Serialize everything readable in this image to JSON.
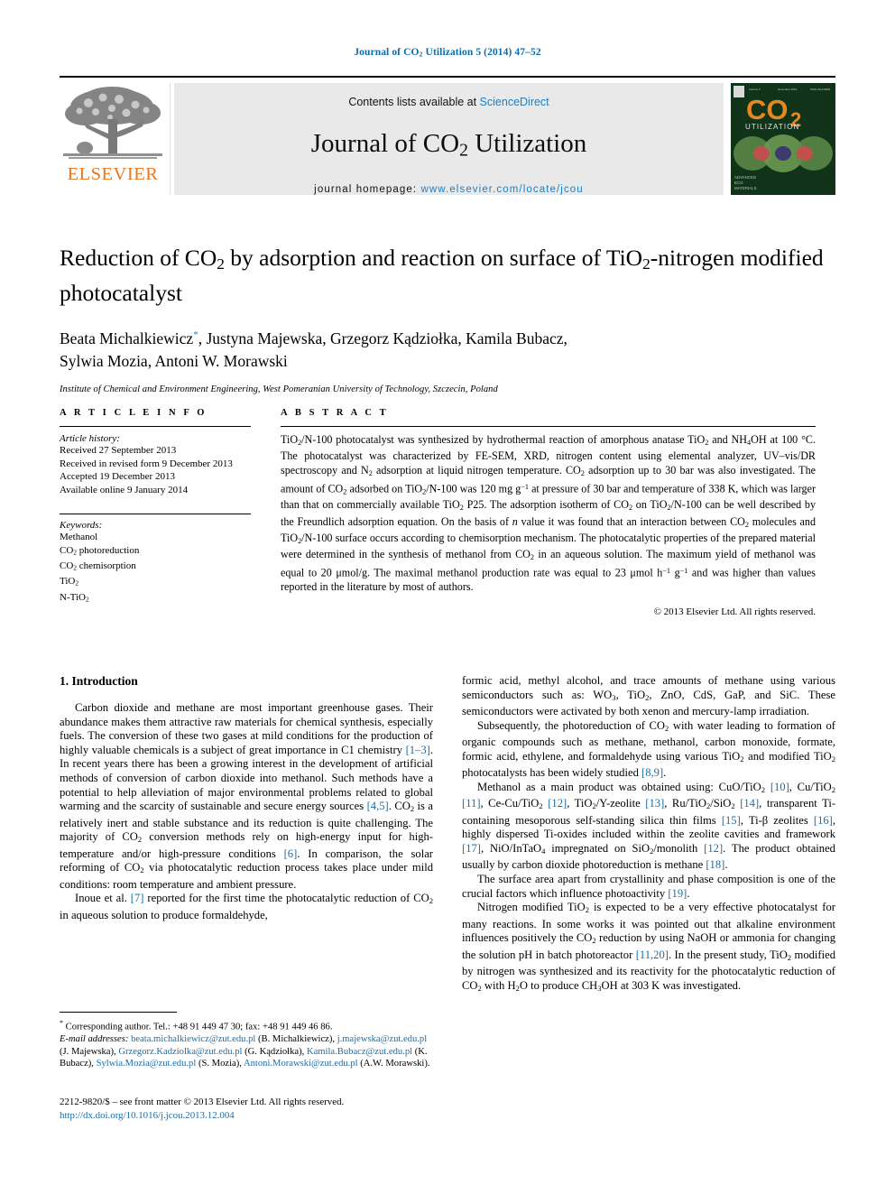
{
  "running_head": "Journal of CO2 Utilization 5 (2014) 47–52",
  "masthead": {
    "contents_prefix": "Contents lists available at ",
    "sciencedirect": "ScienceDirect",
    "journal_title": "Journal of CO2 Utilization",
    "homepage_label": "journal homepage: ",
    "homepage_url": "www.elsevier.com/locate/jcou",
    "publisher": "ELSEVIER",
    "cover": {
      "title": "CO",
      "subscript": "2",
      "subtitle": "UTILIZATION",
      "top_bar": "Volume 5    December 2014    ISSN 2212-9820",
      "footer": "ADVANCED\nECO\nMATERIALS"
    },
    "accent_link_color": "#1b7fc4",
    "elsevier_orange": "#E87722",
    "mast_bg": "#e9e9e9"
  },
  "article": {
    "title_line1": "Reduction of CO2 by adsorption and reaction on surface of TiO2-nitrogen",
    "title_line2": "modified photocatalyst",
    "authors_line1": "Beata Michalkiewicz",
    "authors_line1_rest": ", Justyna Majewska, Grzegorz Kądziołka, Kamila Bubacz,",
    "authors_line2": "Sylwia Mozia, Antoni W. Morawski",
    "corresponding_marker": "*",
    "affiliation": "Institute of Chemical and Environment Engineering, West Pomeranian University of Technology, Szczecin, Poland"
  },
  "article_info": {
    "heading": "A R T I C L E  I N F O",
    "history_label": "Article history:",
    "history": [
      "Received 27 September 2013",
      "Received in revised form 9 December 2013",
      "Accepted 19 December 2013",
      "Available online 9 January 2014"
    ],
    "keywords_label": "Keywords:",
    "keywords": [
      "Methanol",
      "CO2 photoreduction",
      "CO2 chemisorption",
      "TiO2",
      "N-TiO2"
    ]
  },
  "abstract": {
    "heading": "A B S T R A C T",
    "text": "TiO2/N-100 photocatalyst was synthesized by hydrothermal reaction of amorphous anatase TiO2 and NH4OH at 100 °C. The photocatalyst was characterized by FE-SEM, XRD, nitrogen content using elemental analyzer, UV–vis/DR spectroscopy and N2 adsorption at liquid nitrogen temperature. CO2 adsorption up to 30 bar was also investigated. The amount of CO2 adsorbed on TiO2/N-100 was 120 mg g−1 at pressure of 30 bar and temperature of 338 K, which was larger than that on commercially available TiO2 P25. The adsorption isotherm of CO2 on TiO2/N-100 can be well described by the Freundlich adsorption equation. On the basis of n value it was found that an interaction between CO2 molecules and TiO2/N-100 surface occurs according to chemisorption mechanism. The photocatalytic properties of the prepared material were determined in the synthesis of methanol from CO2 in an aqueous solution. The maximum yield of methanol was equal to 20 μmol/g. The maximal methanol production rate was equal to 23 μmol h−1 g−1 and was higher than values reported in the literature by most of authors.",
    "copyright": "© 2013 Elsevier Ltd. All rights reserved."
  },
  "introduction": {
    "heading": "1. Introduction",
    "left_paragraphs": [
      "Carbon dioxide and methane are most important greenhouse gases. Their abundance makes them attractive raw materials for chemical synthesis, especially fuels. The conversion of these two gases at mild conditions for the production of highly valuable chemicals is a subject of great importance in C1 chemistry [1–3]. In recent years there has been a growing interest in the development of artificial methods of conversion of carbon dioxide into methanol. Such methods have a potential to help alleviation of major environmental problems related to global warming and the scarcity of sustainable and secure energy sources [4,5]. CO2 is a relatively inert and stable substance and its reduction is quite challenging. The majority of CO2 conversion methods rely on high-energy input for high-temperature and/or high-pressure conditions [6]. In comparison, the solar reforming of CO2 via photocatalytic reduction process takes place under mild conditions: room temperature and ambient pressure.",
      "Inoue et al. [7] reported for the first time the photocatalytic reduction of CO2 in aqueous solution to produce formaldehyde,"
    ],
    "right_paragraphs": [
      "formic acid, methyl alcohol, and trace amounts of methane using various semiconductors such as: WO3, TiO2, ZnO, CdS, GaP, and SiC. These semiconductors were activated by both xenon and mercury-lamp irradiation.",
      "Subsequently, the photoreduction of CO2 with water leading to formation of organic compounds such as methane, methanol, carbon monoxide, formate, formic acid, ethylene, and formaldehyde using various TiO2 and modified TiO2 photocatalysts has been widely studied [8,9].",
      "Methanol as a main product was obtained using: CuO/TiO2 [10], Cu/TiO2 [11], Ce-Cu/TiO2 [12], TiO2/Y-zeolite [13], Ru/TiO2/SiO2 [14], transparent Ti-containing mesoporous self-standing silica thin films [15], Ti-β zeolites [16], highly dispersed Ti-oxides included within the zeolite cavities and framework [17], NiO/InTaO4 impregnated on SiO2/monolith [12]. The product obtained usually by carbon dioxide photoreduction is methane [18].",
      "The surface area apart from crystallinity and phase composition is one of the crucial factors which influence photoactivity [19].",
      "Nitrogen modified TiO2 is expected to be a very effective photocatalyst for many reactions. In some works it was pointed out that alkaline environment influences positively the CO2 reduction by using NaOH or ammonia for changing the solution pH in batch photoreactor [11,20]. In the present study, TiO2 modified by nitrogen was synthesized and its reactivity for the photocatalytic reduction of CO2 with H2O to produce CH3OH at 303 K was investigated."
    ]
  },
  "footnotes": {
    "corresponding": "Corresponding author. Tel.: +48 91 449 47 30; fax: +48 91 449 46 86.",
    "email_label": "E-mail addresses:",
    "emails": [
      {
        "address": "beata.michalkiewicz@zut.edu.pl",
        "name": "(B. Michalkiewicz),"
      },
      {
        "address": "j.majewska@zut.edu.pl",
        "name": "(J. Majewska),"
      },
      {
        "address": "Grzegorz.Kadziolka@zut.edu.pl",
        "name": "(G. Kądziołka),"
      },
      {
        "address": "Kamila.Bubacz@zut.edu.pl",
        "name": "(K. Bubacz),"
      },
      {
        "address": "Sylwia.Mozia@zut.edu.pl",
        "name": "(S. Mozia),"
      },
      {
        "address": "Antoni.Morawski@zut.edu.pl",
        "name": "(A.W. Morawski)."
      }
    ]
  },
  "imprint": {
    "line1": "2212-9820/$ – see front matter © 2013 Elsevier Ltd. All rights reserved.",
    "doi": "http://dx.doi.org/10.1016/j.jcou.2013.12.004"
  }
}
